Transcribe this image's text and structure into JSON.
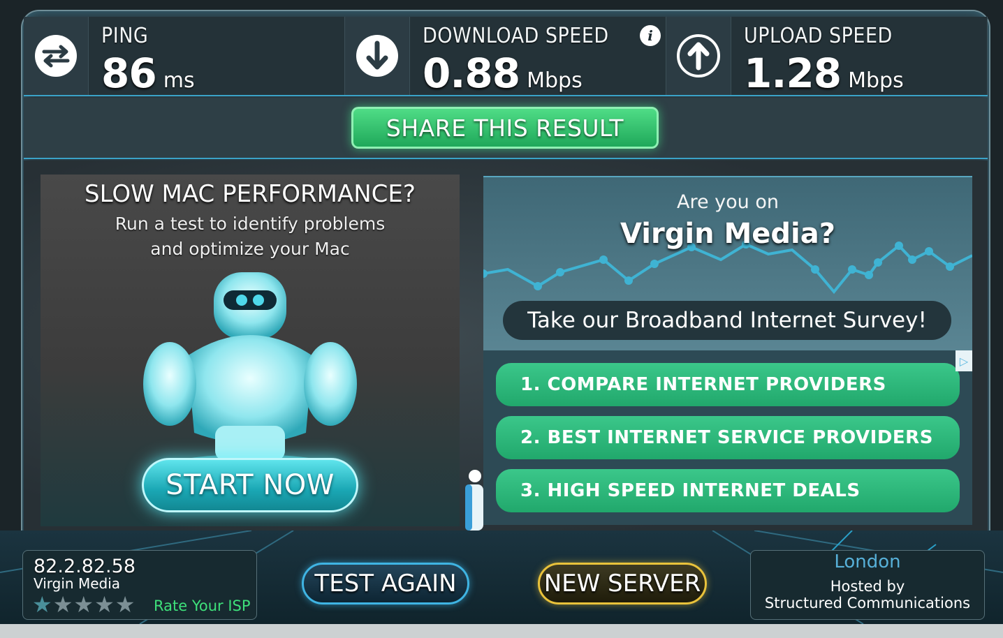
{
  "metrics": {
    "ping": {
      "label": "PING",
      "value": "86",
      "unit": "ms",
      "icon": "transfer-arrows-icon"
    },
    "download": {
      "label": "DOWNLOAD SPEED",
      "value": "0.88",
      "unit": "Mbps",
      "icon": "download-arrow-icon",
      "info_icon": "info-icon"
    },
    "upload": {
      "label": "UPLOAD SPEED",
      "value": "1.28",
      "unit": "Mbps",
      "icon": "upload-arrow-icon"
    }
  },
  "share_button": "SHARE THIS RESULT",
  "left_ad": {
    "title": "SLOW MAC PERFORMANCE?",
    "line1": "Run a test to identify problems",
    "line2": "and optimize your Mac",
    "button": "START NOW"
  },
  "right_ad": {
    "question_top": "Are you on",
    "question_main": "Virgin Media?",
    "survey": "Take our Broadband Internet Survey!",
    "links": [
      "1.  COMPARE INTERNET PROVIDERS",
      "2.  BEST INTERNET SERVICE PROVIDERS",
      "3.  HIGH SPEED INTERNET DEALS"
    ]
  },
  "isp": {
    "ip": "82.2.82.58",
    "name": "Virgin Media",
    "rating": 1,
    "rating_max": 5,
    "rate_label": "Rate Your ISP"
  },
  "buttons": {
    "test_again": "TEST AGAIN",
    "new_server": "NEW SERVER"
  },
  "server": {
    "city": "London",
    "hosted_by": "Hosted by",
    "org": "Structured Communications"
  },
  "colors": {
    "accent_green": "#2bbf72",
    "accent_blue": "#3fb4e3",
    "accent_gold": "#e9c23b"
  }
}
